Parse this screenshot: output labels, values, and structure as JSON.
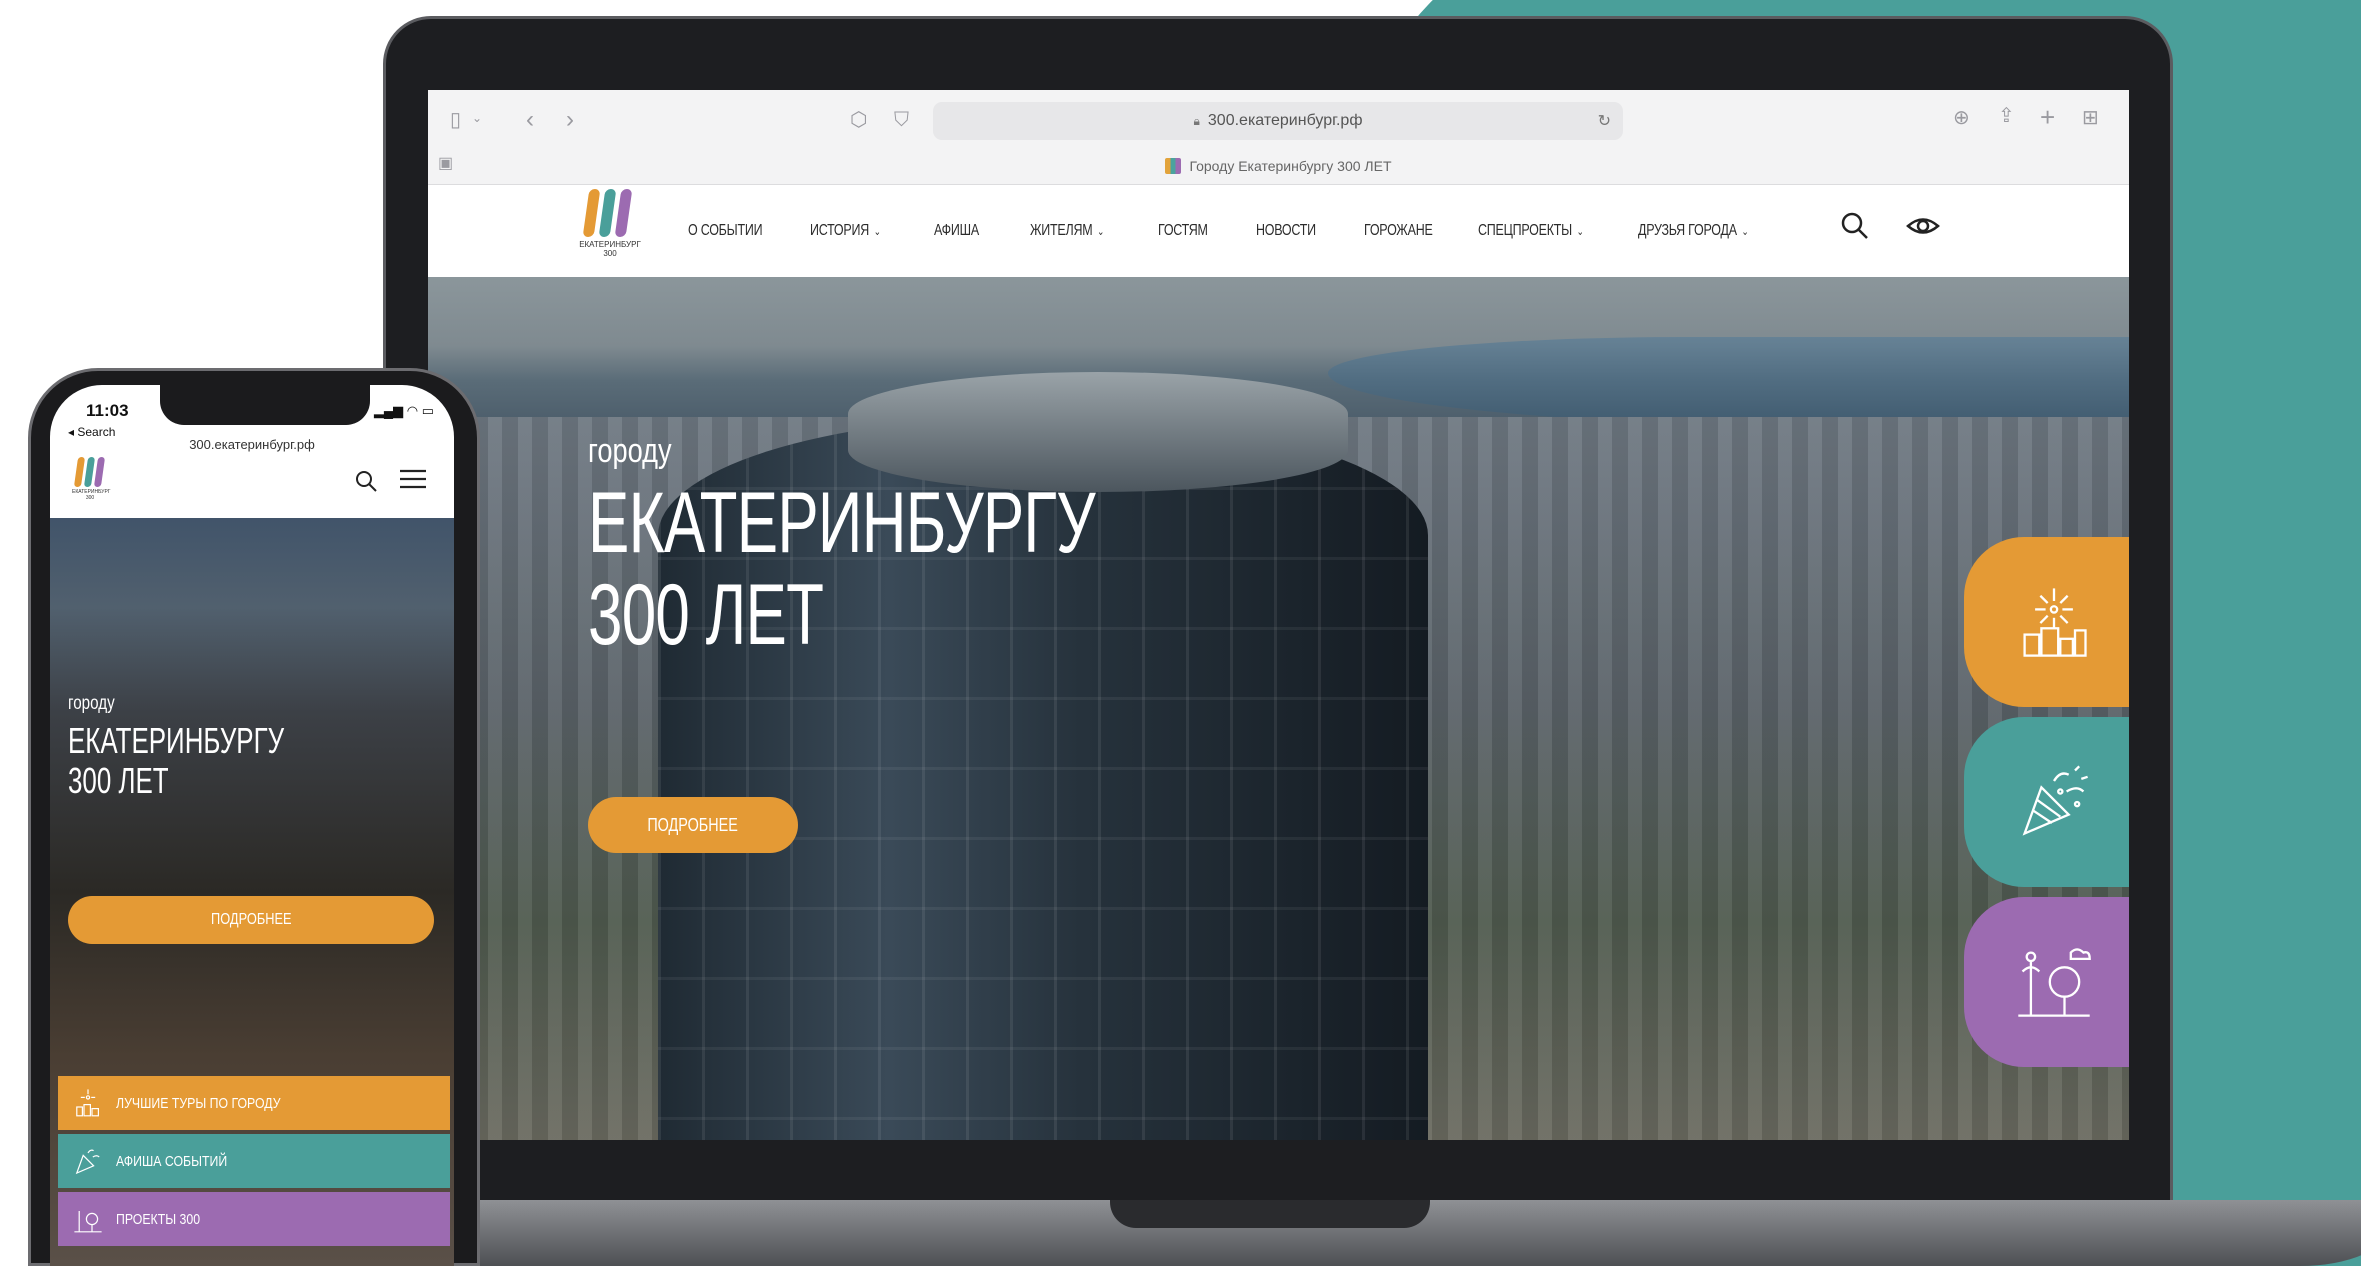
{
  "browser": {
    "url": "300.екатеринбург.рф",
    "tab_title": "Городу Екатеринбургу 300 ЛЕТ"
  },
  "site": {
    "logo_caption": "ЕКАТЕРИНБУРГ 300",
    "nav": [
      {
        "label": "О СОБЫТИИ",
        "dropdown": false
      },
      {
        "label": "ИСТОРИЯ",
        "dropdown": true
      },
      {
        "label": "АФИША",
        "dropdown": false
      },
      {
        "label": "ЖИТЕЛЯМ",
        "dropdown": true
      },
      {
        "label": "ГОСТЯМ",
        "dropdown": false
      },
      {
        "label": "НОВОСТИ",
        "dropdown": false
      },
      {
        "label": "ГОРОЖАНЕ",
        "dropdown": false
      },
      {
        "label": "СПЕЦПРОЕКТЫ",
        "dropdown": true
      },
      {
        "label": "ДРУЗЬЯ ГОРОДА",
        "dropdown": true
      }
    ],
    "icons": {
      "search": "search-icon",
      "accessibility": "eye-icon"
    },
    "hero": {
      "subtitle": "городу",
      "title_line1": "ЕКАТЕРИНБУРГУ",
      "title_line2": "300 ЛЕТ",
      "button": "ПОДРОБНЕЕ"
    },
    "side_tabs": [
      {
        "icon": "fireworks-city-icon",
        "color": "#e49a35"
      },
      {
        "icon": "party-popper-icon",
        "color": "#4a9f9a"
      },
      {
        "icon": "park-icon",
        "color": "#9c6bb1"
      }
    ]
  },
  "phone": {
    "time": "11:03",
    "back_label": "◂ Search",
    "url": "300.екатеринбург.рф",
    "hero": {
      "subtitle": "городу",
      "title_line1": "ЕКАТЕРИНБУРГУ",
      "title_line2": "300 ЛЕТ",
      "button": "ПОДРОБНЕЕ"
    },
    "strips": [
      {
        "label": "ЛУЧШИЕ ТУРЫ ПО ГОРОДУ",
        "color": "#e49a35",
        "icon": "fireworks-city-icon"
      },
      {
        "label": "АФИША СОБЫТИЙ",
        "color": "#4a9f9a",
        "icon": "party-popper-icon"
      },
      {
        "label": "ПРОЕКТЫ 300",
        "color": "#9c6bb1",
        "icon": "park-icon"
      }
    ]
  },
  "colors": {
    "accent_orange": "#e49a35",
    "accent_teal": "#4a9f9a",
    "accent_purple": "#9c6bb1"
  }
}
